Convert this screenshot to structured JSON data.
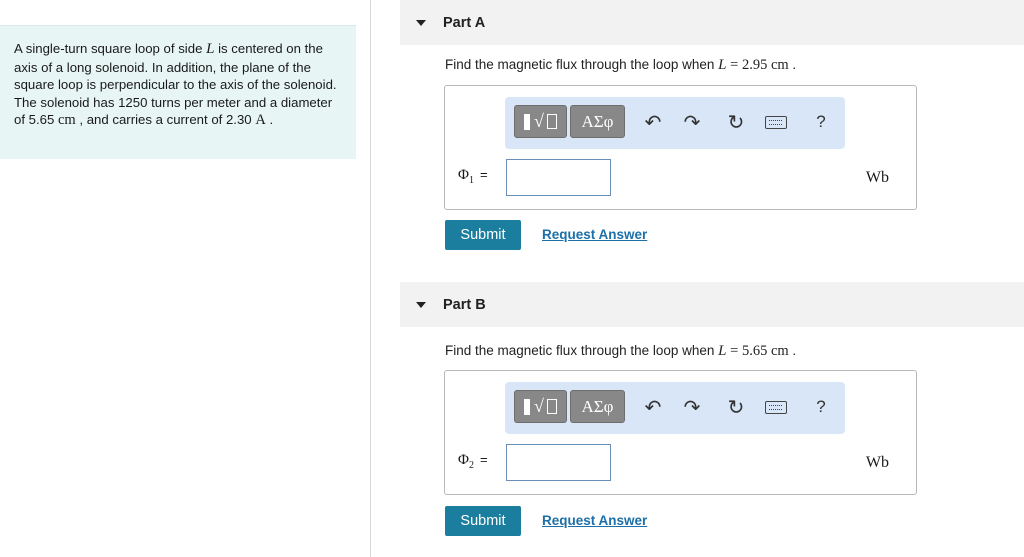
{
  "problem": {
    "text_1": "A single-turn square loop of side ",
    "var_L": "L",
    "text_2": " is centered on the axis of a long solenoid. In addition, the plane of the square loop is perpendicular to the axis of the solenoid. The solenoid has 1250 turns per meter and a diameter of 5.65 ",
    "unit_cm": "cm",
    "text_3": " , and carries a current of 2.30 ",
    "unit_A": "A",
    "text_4": " ."
  },
  "parts": [
    {
      "title": "Part A",
      "question_prefix": "Find the magnetic flux through the loop when ",
      "var": "L",
      "equals": " = 2.95 ",
      "unit": "cm",
      "suffix": " .",
      "answer_symbol": "Φ",
      "answer_sub": "1",
      "answer_eq": "=",
      "answer_value": "",
      "answer_unit": "Wb",
      "submit_label": "Submit",
      "request_label": "Request Answer"
    },
    {
      "title": "Part B",
      "question_prefix": "Find the magnetic flux through the loop when ",
      "var": "L",
      "equals": " = 5.65 ",
      "unit": "cm",
      "suffix": " .",
      "answer_symbol": "Φ",
      "answer_sub": "2",
      "answer_eq": "=",
      "answer_value": "",
      "answer_unit": "Wb",
      "submit_label": "Submit",
      "request_label": "Request Answer"
    }
  ],
  "toolbar": {
    "greek_label": "ΑΣφ",
    "undo_icon": "↶",
    "redo_icon": "↷",
    "reset_icon": "↻",
    "help_label": "?",
    "root_symbol": "√"
  },
  "colors": {
    "problem_bg": "#e8f5f5",
    "toolbar_bg": "#d8e6f7",
    "submit_bg": "#1b7e9e",
    "link": "#1c6fa8"
  }
}
